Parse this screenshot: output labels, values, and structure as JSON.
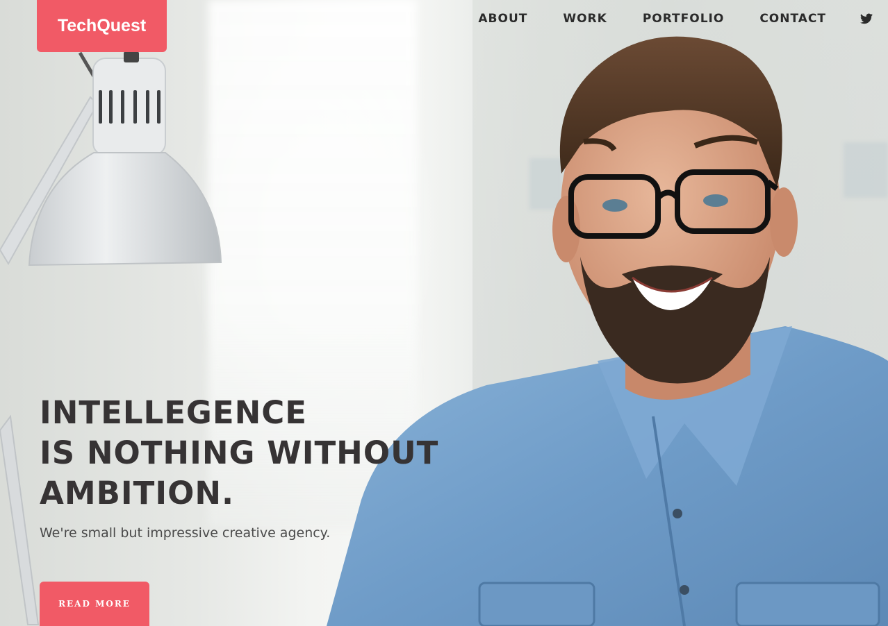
{
  "brand": {
    "name": "TechQuest",
    "accent": "#f15a66"
  },
  "nav": {
    "items": [
      {
        "label": "ABOUT"
      },
      {
        "label": "WORK"
      },
      {
        "label": "PORTFOLIO"
      },
      {
        "label": "CONTACT"
      }
    ],
    "social_icon": "twitter-icon"
  },
  "hero": {
    "headline_lines": [
      "INTELLEGENCE",
      "IS NOTHING WITHOUT",
      "AMBITION."
    ],
    "subtitle": "We're small but impressive creative agency.",
    "cta_label": "READ MORE",
    "text_color": "#363334"
  }
}
